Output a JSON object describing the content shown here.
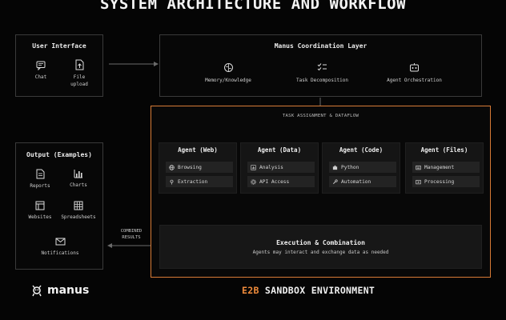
{
  "title": "SYSTEM ARCHITECTURE AND WORKFLOW",
  "user_interface": {
    "title": "User Interface",
    "items": [
      {
        "label": "Chat",
        "icon": "chat-icon"
      },
      {
        "label": "File\nupload",
        "icon": "file-upload-icon"
      }
    ]
  },
  "coordination": {
    "title": "Manus Coordination Layer",
    "items": [
      {
        "label": "Memory/Knowledge",
        "icon": "brain-icon"
      },
      {
        "label": "Task Decomposition",
        "icon": "checklist-icon"
      },
      {
        "label": "Agent Orchestration",
        "icon": "bot-icon"
      }
    ]
  },
  "sandbox": {
    "header": "TASK ASSIGNMENT & DATAFLOW",
    "label_accent": "E2B",
    "label_rest": "SANDBOX ENVIRONMENT",
    "agents": [
      {
        "title": "Agent (Web)",
        "chips": [
          {
            "label": "Browsing",
            "icon": "globe-icon"
          },
          {
            "label": "Extraction",
            "icon": "pin-icon"
          }
        ]
      },
      {
        "title": "Agent (Data)",
        "chips": [
          {
            "label": "Analysis",
            "icon": "chart-icon"
          },
          {
            "label": "API Access",
            "icon": "gear-icon"
          }
        ]
      },
      {
        "title": "Agent (Code)",
        "chips": [
          {
            "label": "Python",
            "icon": "puzzle-icon"
          },
          {
            "label": "Automation",
            "icon": "wrench-icon"
          }
        ]
      },
      {
        "title": "Agent (Files)",
        "chips": [
          {
            "label": "Management",
            "icon": "folder-icon"
          },
          {
            "label": "Processing",
            "icon": "convert-icon"
          }
        ]
      }
    ],
    "execution": {
      "title": "Execution & Combination",
      "subtitle": "Agents may interact and exchange data as needed"
    }
  },
  "combined_results": "COMBINED\nRESULTS",
  "output": {
    "title": "Output (Examples)",
    "items": [
      {
        "label": "Reports",
        "icon": "report-icon"
      },
      {
        "label": "Charts",
        "icon": "bar-chart-icon"
      },
      {
        "label": "Websites",
        "icon": "website-icon"
      },
      {
        "label": "Spreadsheets",
        "icon": "spreadsheet-icon"
      },
      {
        "label": "Notifications",
        "icon": "mail-icon"
      }
    ]
  },
  "brand": "manus",
  "colors": {
    "accent": "#ef8b3b",
    "sandbox_border": "#d87b36"
  }
}
